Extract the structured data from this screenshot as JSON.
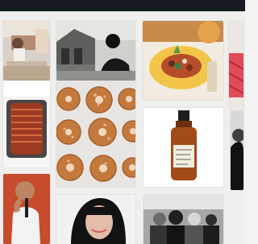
{
  "app": {
    "header_color": "#161b22"
  },
  "tiles": [
    {
      "name": "tile-dining-room-photo",
      "subject": "photo"
    },
    {
      "name": "tile-house-portrait-photo",
      "subject": "photo"
    },
    {
      "name": "tile-food-bowl-photo",
      "subject": "photo"
    },
    {
      "name": "tile-red-fabric-photo",
      "subject": "photo"
    },
    {
      "name": "tile-roast-pan-photo",
      "subject": "photo"
    },
    {
      "name": "tile-donuts-photo",
      "subject": "photo"
    },
    {
      "name": "tile-amber-bottle-photo",
      "subject": "photo"
    },
    {
      "name": "tile-dark-portrait-photo",
      "subject": "photo"
    },
    {
      "name": "tile-singer-photo",
      "subject": "photo"
    },
    {
      "name": "tile-woman-portrait-photo",
      "subject": "photo"
    },
    {
      "name": "tile-group-photo",
      "subject": "photo"
    }
  ]
}
